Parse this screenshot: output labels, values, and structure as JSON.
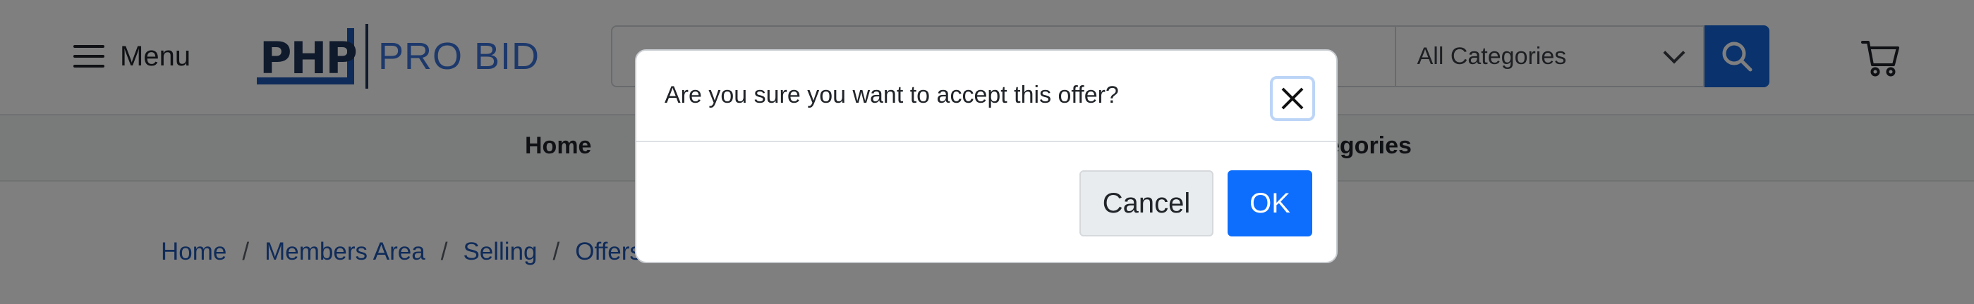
{
  "header": {
    "menu_label": "Menu",
    "logo": {
      "mark": "PHP",
      "text": "PRO BID"
    },
    "search": {
      "placeholder": "",
      "category": "All Categories"
    }
  },
  "nav": {
    "items": [
      "Home",
      "egories"
    ]
  },
  "breadcrumb": [
    "Home",
    "Members Area",
    "Selling",
    "Offers"
  ],
  "modal": {
    "message": "Are you sure you want to accept this offer?",
    "cancel_label": "Cancel",
    "ok_label": "OK"
  },
  "colors": {
    "primary": "#0d6efd",
    "search_button": "#1565d8",
    "link": "#1f56b4",
    "logo_dark": "#1f3558",
    "logo_light": "#3a72d8"
  },
  "icons": {
    "menu": "hamburger-icon",
    "search": "search-icon",
    "cart": "cart-icon",
    "close": "close-icon",
    "dropdown": "chevron-down-icon"
  }
}
